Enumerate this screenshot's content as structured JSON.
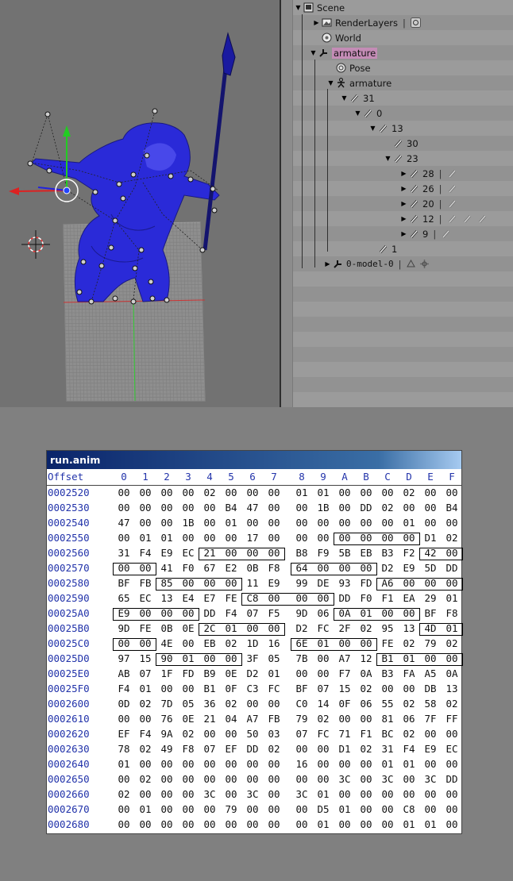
{
  "outliner": {
    "items": [
      {
        "label": "Scene",
        "icon": "scene-icon",
        "tri": "down"
      },
      {
        "label": "RenderLayers",
        "icon": "render-layers-icon",
        "tri": "right"
      },
      {
        "label": "World",
        "icon": "world-icon",
        "tri": ""
      },
      {
        "label": "armature",
        "icon": "armature-object-icon",
        "tri": "down"
      },
      {
        "label": "Pose",
        "icon": "pose-icon",
        "tri": ""
      },
      {
        "label": "armature",
        "icon": "armature-data-icon",
        "tri": "down"
      },
      {
        "label": "31",
        "icon": "bone-icon",
        "tri": "down"
      },
      {
        "label": "0",
        "icon": "bone-icon",
        "tri": "down"
      },
      {
        "label": "13",
        "icon": "bone-icon",
        "tri": "down"
      },
      {
        "label": "30",
        "icon": "bone-icon",
        "tri": ""
      },
      {
        "label": "23",
        "icon": "bone-icon",
        "tri": "down"
      },
      {
        "label": "28",
        "icon": "bone-icon",
        "tri": "right"
      },
      {
        "label": "26",
        "icon": "bone-icon",
        "tri": "right"
      },
      {
        "label": "20",
        "icon": "bone-icon",
        "tri": "right"
      },
      {
        "label": "12",
        "icon": "bone-icon",
        "tri": "right"
      },
      {
        "label": "9",
        "icon": "bone-icon",
        "tri": "right"
      },
      {
        "label": "1",
        "icon": "bone-icon",
        "tri": ""
      },
      {
        "label": "0-model-0",
        "icon": "armature-object-icon",
        "tri": "right"
      }
    ]
  },
  "hex": {
    "title": "run.anim",
    "offset_label": "Offset",
    "columns": [
      "0",
      "1",
      "2",
      "3",
      "4",
      "5",
      "6",
      "7",
      "8",
      "9",
      "A",
      "B",
      "C",
      "D",
      "E",
      "F"
    ],
    "rows": [
      {
        "offset": "0002520",
        "bytes": [
          "00",
          "00",
          "00",
          "00",
          "02",
          "00",
          "00",
          "00",
          "01",
          "01",
          "00",
          "00",
          "00",
          "02",
          "00",
          "00"
        ]
      },
      {
        "offset": "0002530",
        "bytes": [
          "00",
          "00",
          "00",
          "00",
          "00",
          "B4",
          "47",
          "00",
          "00",
          "1B",
          "00",
          "DD",
          "02",
          "00",
          "00",
          "B4"
        ]
      },
      {
        "offset": "0002540",
        "bytes": [
          "47",
          "00",
          "00",
          "1B",
          "00",
          "01",
          "00",
          "00",
          "00",
          "00",
          "00",
          "00",
          "00",
          "01",
          "00",
          "00"
        ]
      },
      {
        "offset": "0002550",
        "bytes": [
          "00",
          "01",
          "01",
          "00",
          "00",
          "00",
          "17",
          "00",
          "00",
          "00",
          "00",
          "00",
          "00",
          "00",
          "D1",
          "02"
        ]
      },
      {
        "offset": "0002560",
        "bytes": [
          "31",
          "F4",
          "E9",
          "EC",
          "21",
          "00",
          "00",
          "00",
          "B8",
          "F9",
          "5B",
          "EB",
          "B3",
          "F2",
          "42",
          "00"
        ]
      },
      {
        "offset": "0002570",
        "bytes": [
          "00",
          "00",
          "41",
          "F0",
          "67",
          "E2",
          "0B",
          "F8",
          "64",
          "00",
          "00",
          "00",
          "D2",
          "E9",
          "5D",
          "DD"
        ]
      },
      {
        "offset": "0002580",
        "bytes": [
          "BF",
          "FB",
          "85",
          "00",
          "00",
          "00",
          "11",
          "E9",
          "99",
          "DE",
          "93",
          "FD",
          "A6",
          "00",
          "00",
          "00"
        ]
      },
      {
        "offset": "0002590",
        "bytes": [
          "65",
          "EC",
          "13",
          "E4",
          "E7",
          "FE",
          "C8",
          "00",
          "00",
          "00",
          "DD",
          "F0",
          "F1",
          "EA",
          "29",
          "01"
        ]
      },
      {
        "offset": "00025A0",
        "bytes": [
          "E9",
          "00",
          "00",
          "00",
          "DD",
          "F4",
          "07",
          "F5",
          "9D",
          "06",
          "0A",
          "01",
          "00",
          "00",
          "BF",
          "F8"
        ]
      },
      {
        "offset": "00025B0",
        "bytes": [
          "9D",
          "FE",
          "0B",
          "0E",
          "2C",
          "01",
          "00",
          "00",
          "D2",
          "FC",
          "2F",
          "02",
          "95",
          "13",
          "4D",
          "01"
        ]
      },
      {
        "offset": "00025C0",
        "bytes": [
          "00",
          "00",
          "4E",
          "00",
          "EB",
          "02",
          "1D",
          "16",
          "6E",
          "01",
          "00",
          "00",
          "FE",
          "02",
          "79",
          "02"
        ]
      },
      {
        "offset": "00025D0",
        "bytes": [
          "97",
          "15",
          "90",
          "01",
          "00",
          "00",
          "3F",
          "05",
          "7B",
          "00",
          "A7",
          "12",
          "B1",
          "01",
          "00",
          "00"
        ]
      },
      {
        "offset": "00025E0",
        "bytes": [
          "AB",
          "07",
          "1F",
          "FD",
          "B9",
          "0E",
          "D2",
          "01",
          "00",
          "00",
          "F7",
          "0A",
          "B3",
          "FA",
          "A5",
          "0A"
        ]
      },
      {
        "offset": "00025F0",
        "bytes": [
          "F4",
          "01",
          "00",
          "00",
          "B1",
          "0F",
          "C3",
          "FC",
          "BF",
          "07",
          "15",
          "02",
          "00",
          "00",
          "DB",
          "13"
        ]
      },
      {
        "offset": "0002600",
        "bytes": [
          "0D",
          "02",
          "7D",
          "05",
          "36",
          "02",
          "00",
          "00",
          "C0",
          "14",
          "0F",
          "06",
          "55",
          "02",
          "58",
          "02"
        ]
      },
      {
        "offset": "0002610",
        "bytes": [
          "00",
          "00",
          "76",
          "0E",
          "21",
          "04",
          "A7",
          "FB",
          "79",
          "02",
          "00",
          "00",
          "81",
          "06",
          "7F",
          "FF"
        ]
      },
      {
        "offset": "0002620",
        "bytes": [
          "EF",
          "F4",
          "9A",
          "02",
          "00",
          "00",
          "50",
          "03",
          "07",
          "FC",
          "71",
          "F1",
          "BC",
          "02",
          "00",
          "00"
        ]
      },
      {
        "offset": "0002630",
        "bytes": [
          "78",
          "02",
          "49",
          "F8",
          "07",
          "EF",
          "DD",
          "02",
          "00",
          "00",
          "D1",
          "02",
          "31",
          "F4",
          "E9",
          "EC"
        ]
      },
      {
        "offset": "0002640",
        "bytes": [
          "01",
          "00",
          "00",
          "00",
          "00",
          "00",
          "00",
          "00",
          "16",
          "00",
          "00",
          "00",
          "01",
          "01",
          "00",
          "00"
        ]
      },
      {
        "offset": "0002650",
        "bytes": [
          "00",
          "02",
          "00",
          "00",
          "00",
          "00",
          "00",
          "00",
          "00",
          "00",
          "3C",
          "00",
          "3C",
          "00",
          "3C",
          "DD"
        ]
      },
      {
        "offset": "0002660",
        "bytes": [
          "02",
          "00",
          "00",
          "00",
          "3C",
          "00",
          "3C",
          "00",
          "3C",
          "01",
          "00",
          "00",
          "00",
          "00",
          "00",
          "00"
        ]
      },
      {
        "offset": "0002670",
        "bytes": [
          "00",
          "01",
          "00",
          "00",
          "00",
          "79",
          "00",
          "00",
          "00",
          "D5",
          "01",
          "00",
          "00",
          "C8",
          "00",
          "00"
        ]
      },
      {
        "offset": "0002680",
        "bytes": [
          "00",
          "00",
          "00",
          "00",
          "00",
          "00",
          "00",
          "00",
          "00",
          "01",
          "00",
          "00",
          "00",
          "01",
          "01",
          "00"
        ]
      }
    ],
    "boxes": [
      {
        "row": 3,
        "start": 10,
        "len": 4
      },
      {
        "row": 4,
        "start": 4,
        "len": 4
      },
      {
        "row": 4,
        "start": 14,
        "len": 2
      },
      {
        "row": 5,
        "start": 0,
        "len": 2
      },
      {
        "row": 5,
        "start": 8,
        "len": 4
      },
      {
        "row": 6,
        "start": 2,
        "len": 4
      },
      {
        "row": 6,
        "start": 12,
        "len": 4
      },
      {
        "row": 7,
        "start": 6,
        "len": 4
      },
      {
        "row": 8,
        "start": 0,
        "len": 4
      },
      {
        "row": 8,
        "start": 10,
        "len": 4
      },
      {
        "row": 9,
        "start": 4,
        "len": 4
      },
      {
        "row": 9,
        "start": 14,
        "len": 2
      },
      {
        "row": 10,
        "start": 0,
        "len": 2
      },
      {
        "row": 10,
        "start": 8,
        "len": 4
      },
      {
        "row": 11,
        "start": 2,
        "len": 4
      },
      {
        "row": 11,
        "start": 12,
        "len": 4
      }
    ]
  }
}
